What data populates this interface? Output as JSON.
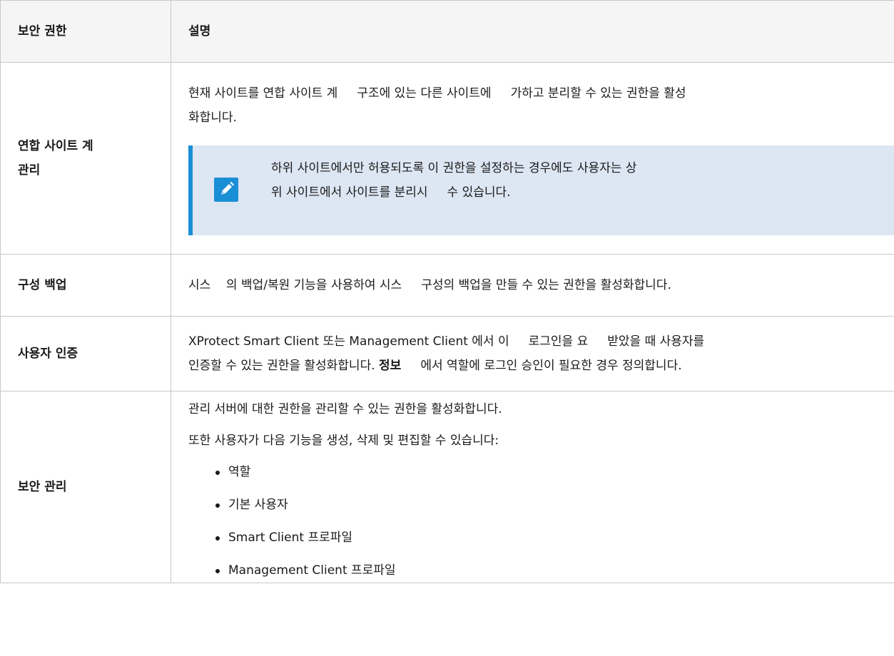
{
  "table": {
    "headers": {
      "permission": "보안 권한",
      "description": "설명"
    },
    "rows": [
      {
        "name": "연합 사이트 계 관리",
        "name_line1": "연합 사이트 계",
        "name_line2": "관리",
        "desc_line1": "현재 사이트를 연합 사이트 계     구조에 있는 다른 사이트에     가하고 분리할 수 있는 권한을 활성",
        "desc_line2": "화합니다.",
        "note": {
          "icon": "pencil-icon",
          "line1": "하위 사이트에서만 허용되도록 이 권한을 설정하는 경우에도 사용자는 상",
          "line2": "위 사이트에서 사이트를 분리시     수 있습니다."
        }
      },
      {
        "name": "구성 백업",
        "desc": "시스    의 백업/복원 기능을 사용하여 시스     구성의 백업을 만들 수 있는 권한을 활성화합니다."
      },
      {
        "name": "사용자 인증",
        "desc_line1": "XProtect Smart Client 또는 Management Client 에서 이     로그인을 요     받았을 때 사용자를",
        "desc_line2_pre": "인증할 수 있는 권한을 활성화합니다.",
        "desc_line2_bold": "정보",
        "desc_line2_post": "에서 역할에 로그인 승인이 필요한 경우 정의합니다."
      },
      {
        "name": "보안 관리",
        "desc_p1": "관리 서버에 대한 권한을 관리할 수 있는 권한을 활성화합니다.",
        "desc_p2": "또한 사용자가 다음 기능을 생성, 삭제 및 편집할 수 있습니다:",
        "items": [
          "역할",
          "기본 사용자",
          "Smart Client 프로파일",
          "Management Client 프로파일"
        ]
      }
    ]
  },
  "colors": {
    "note_background": "#dde6f3",
    "note_accent": "#1b8fd6",
    "header_background": "#f5f5f5",
    "border": "#c8c8c8"
  }
}
